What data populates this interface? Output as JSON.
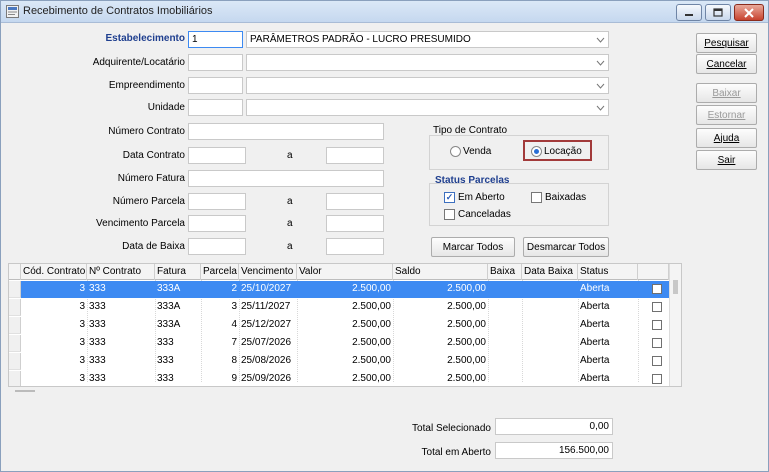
{
  "window": {
    "title": "Recebimento de Contratos Imobiliários"
  },
  "form": {
    "estabelecimento": {
      "label": "Estabelecimento",
      "code": "1",
      "value": "PARÂMETROS PADRÃO - LUCRO PRESUMIDO"
    },
    "adquirente": {
      "label": "Adquirente/Locatário",
      "code": "",
      "value": ""
    },
    "empreendimento": {
      "label": "Empreendimento",
      "code": "",
      "value": ""
    },
    "unidade": {
      "label": "Unidade",
      "code": "",
      "value": ""
    },
    "numero_contrato": {
      "label": "Número Contrato",
      "value": ""
    },
    "data_contrato": {
      "label": "Data Contrato",
      "from": "",
      "to": ""
    },
    "numero_fatura": {
      "label": "Número Fatura",
      "value": ""
    },
    "numero_parcela": {
      "label": "Número Parcela",
      "from": "",
      "to": ""
    },
    "vencimento_parcela": {
      "label": "Vencimento Parcela",
      "from": "",
      "to": ""
    },
    "data_baixa": {
      "label": "Data de Baixa",
      "from": "",
      "to": ""
    },
    "a_label": "a"
  },
  "tipo_contrato": {
    "title": "Tipo de Contrato",
    "venda": "Venda",
    "locacao": "Locação",
    "selected": "locacao"
  },
  "status_parcelas": {
    "title": "Status Parcelas",
    "em_aberto": {
      "label": "Em Aberto",
      "checked": true
    },
    "baixadas": {
      "label": "Baixadas",
      "checked": false
    },
    "canceladas": {
      "label": "Canceladas",
      "checked": false
    }
  },
  "buttons": {
    "marcar_todos": "Marcar Todos",
    "desmarcar_todos": "Desmarcar Todos",
    "pesquisar": "Pesquisar",
    "cancelar": "Cancelar",
    "baixar": "Baixar",
    "estornar": "Estornar",
    "ajuda": "Ajuda",
    "sair": "Sair"
  },
  "grid": {
    "columns": [
      "Cód. Contrato",
      "Nº Contrato",
      "Fatura",
      "Parcela",
      "Vencimento",
      "Valor",
      "Saldo",
      "Baixa",
      "Data Baixa",
      "Status"
    ],
    "rows": [
      {
        "cod": "3",
        "num": "333",
        "fatura": "333A",
        "parcela": "2",
        "vencimento": "25/10/2027",
        "valor": "2.500,00",
        "saldo": "2.500,00",
        "baixa": "",
        "data_baixa": "",
        "status": "Aberta",
        "selected": true
      },
      {
        "cod": "3",
        "num": "333",
        "fatura": "333A",
        "parcela": "3",
        "vencimento": "25/11/2027",
        "valor": "2.500,00",
        "saldo": "2.500,00",
        "baixa": "",
        "data_baixa": "",
        "status": "Aberta",
        "selected": false
      },
      {
        "cod": "3",
        "num": "333",
        "fatura": "333A",
        "parcela": "4",
        "vencimento": "25/12/2027",
        "valor": "2.500,00",
        "saldo": "2.500,00",
        "baixa": "",
        "data_baixa": "",
        "status": "Aberta",
        "selected": false
      },
      {
        "cod": "3",
        "num": "333",
        "fatura": "333",
        "parcela": "7",
        "vencimento": "25/07/2026",
        "valor": "2.500,00",
        "saldo": "2.500,00",
        "baixa": "",
        "data_baixa": "",
        "status": "Aberta",
        "selected": false
      },
      {
        "cod": "3",
        "num": "333",
        "fatura": "333",
        "parcela": "8",
        "vencimento": "25/08/2026",
        "valor": "2.500,00",
        "saldo": "2.500,00",
        "baixa": "",
        "data_baixa": "",
        "status": "Aberta",
        "selected": false
      },
      {
        "cod": "3",
        "num": "333",
        "fatura": "333",
        "parcela": "9",
        "vencimento": "25/09/2026",
        "valor": "2.500,00",
        "saldo": "2.500,00",
        "baixa": "",
        "data_baixa": "",
        "status": "Aberta",
        "selected": false
      }
    ]
  },
  "totals": {
    "selecionado_label": "Total Selecionado",
    "selecionado_value": "0,00",
    "aberto_label": "Total em Aberto",
    "aberto_value": "156.500,00"
  }
}
